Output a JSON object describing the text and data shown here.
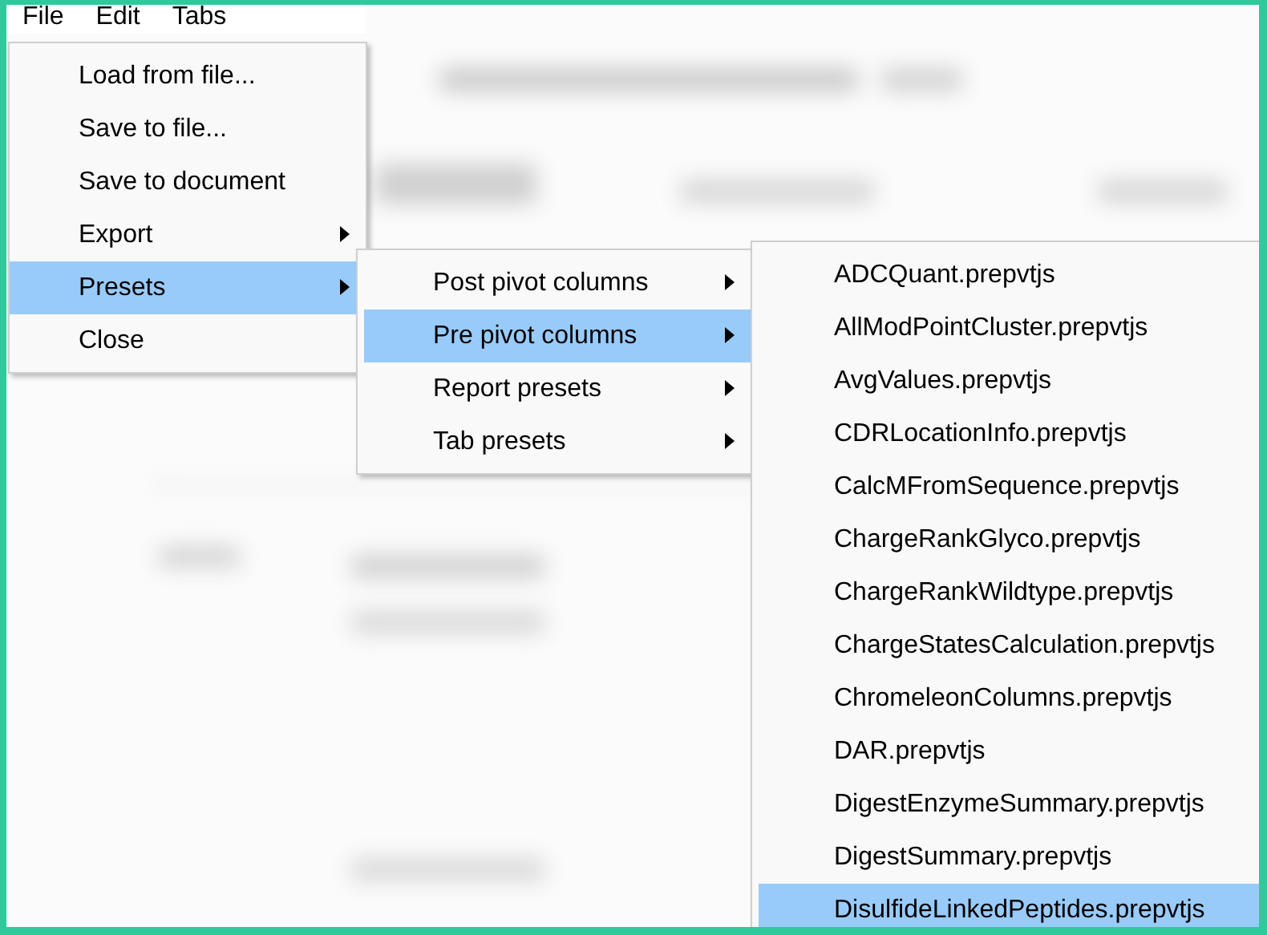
{
  "menu_bar": [
    {
      "label": "File"
    },
    {
      "label": "Edit"
    },
    {
      "label": "Tabs"
    }
  ],
  "file_menu": [
    {
      "label": "Load from file...",
      "submenu": false,
      "selected": false
    },
    {
      "label": "Save to file...",
      "submenu": false,
      "selected": false
    },
    {
      "label": "Save to document",
      "submenu": false,
      "selected": false
    },
    {
      "label": "Export",
      "submenu": true,
      "selected": false
    },
    {
      "label": "Presets",
      "submenu": true,
      "selected": true
    },
    {
      "label": "Close",
      "submenu": false,
      "selected": false
    }
  ],
  "presets_menu": [
    {
      "label": "Post pivot columns",
      "submenu": true,
      "selected": false
    },
    {
      "label": "Pre pivot columns",
      "submenu": true,
      "selected": true
    },
    {
      "label": "Report presets",
      "submenu": true,
      "selected": false
    },
    {
      "label": "Tab presets",
      "submenu": true,
      "selected": false
    }
  ],
  "pre_pivot_menu": [
    {
      "label": "ADCQuant.prepvtjs",
      "selected": false
    },
    {
      "label": "AllModPointCluster.prepvtjs",
      "selected": false
    },
    {
      "label": "AvgValues.prepvtjs",
      "selected": false
    },
    {
      "label": "CDRLocationInfo.prepvtjs",
      "selected": false
    },
    {
      "label": "CalcMFromSequence.prepvtjs",
      "selected": false
    },
    {
      "label": "ChargeRankGlyco.prepvtjs",
      "selected": false
    },
    {
      "label": "ChargeRankWildtype.prepvtjs",
      "selected": false
    },
    {
      "label": "ChargeStatesCalculation.prepvtjs",
      "selected": false
    },
    {
      "label": "ChromeleonColumns.prepvtjs",
      "selected": false
    },
    {
      "label": "DAR.prepvtjs",
      "selected": false
    },
    {
      "label": "DigestEnzymeSummary.prepvtjs",
      "selected": false
    },
    {
      "label": "DigestSummary.prepvtjs",
      "selected": false
    },
    {
      "label": "DisulfideLinkedPeptides.prepvtjs",
      "selected": true
    }
  ]
}
